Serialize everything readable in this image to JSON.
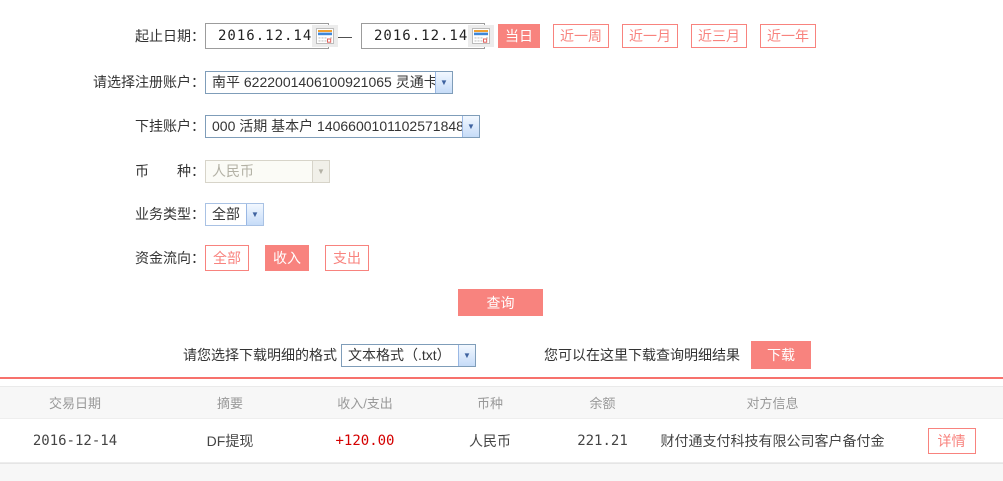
{
  "form": {
    "date_range": {
      "label": "起止日期：",
      "start_value": "2016.12.14",
      "end_value": "2016.12.14",
      "separator": "—",
      "quick_buttons": [
        {
          "label": "当日",
          "active": true
        },
        {
          "label": "近一周",
          "active": false
        },
        {
          "label": "近一月",
          "active": false
        },
        {
          "label": "近三月",
          "active": false
        },
        {
          "label": "近一年",
          "active": false
        }
      ]
    },
    "register_account": {
      "label": "请选择注册账户：",
      "value": "南平 6222001406100921065 灵通卡"
    },
    "sub_account": {
      "label": "下挂账户：",
      "value": "000 活期 基本户 1406600101102571848"
    },
    "currency": {
      "label": "币　　种：",
      "value": "人民币",
      "disabled": true
    },
    "business_type": {
      "label": "业务类型：",
      "value": "全部"
    },
    "fund_flow": {
      "label": "资金流向：",
      "options": [
        {
          "label": "全部",
          "active": false
        },
        {
          "label": "收入",
          "active": true
        },
        {
          "label": "支出",
          "active": false
        }
      ]
    },
    "query_button_label": "查询"
  },
  "download": {
    "format_label": "请您选择下载明细的格式",
    "format_value": "文本格式（.txt）",
    "hint": "您可以在这里下载查询明细结果",
    "button_label": "下载"
  },
  "table": {
    "headers": [
      "交易日期",
      "摘要",
      "收入/支出",
      "币种",
      "余额",
      "对方信息"
    ],
    "rows": [
      {
        "date": "2016-12-14",
        "summary": "DF提现",
        "amount": "+120.00",
        "currency": "人民币",
        "balance": "221.21",
        "counterparty": "财付通支付科技有限公司客户备付金",
        "action_label": "详情"
      }
    ]
  },
  "colors": {
    "accent": "#f8837e",
    "amount_red": "#d40000",
    "separator_red": "#f7716c"
  }
}
